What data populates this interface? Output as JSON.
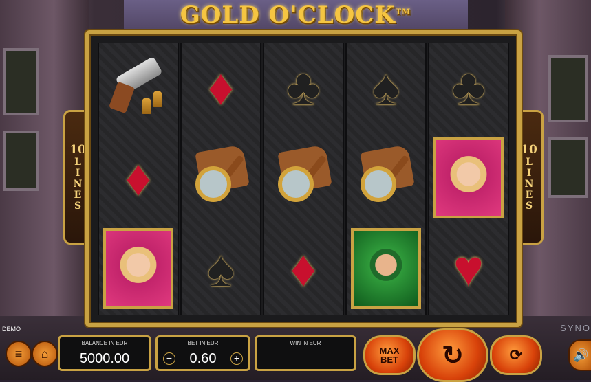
{
  "game": {
    "title": "GOLD O'CLOCK",
    "trademark": "TM",
    "provider": "SYNO"
  },
  "lines_badge": {
    "number": "10",
    "word": "LINES"
  },
  "reels": [
    [
      "revolver",
      "diamond",
      "lady"
    ],
    [
      "diamond",
      "magnifier",
      "spade"
    ],
    [
      "club",
      "magnifier",
      "diamond"
    ],
    [
      "spade",
      "magnifier",
      "detective"
    ],
    [
      "club",
      "lady",
      "heart"
    ]
  ],
  "symbol_glyphs": {
    "diamond": "♦",
    "heart": "♥",
    "club": "♣",
    "spade": "♠"
  },
  "mode": "DEMO",
  "balance": {
    "label": "BALANCE IN EUR",
    "value": "5000.00"
  },
  "bet": {
    "label": "BET IN EUR",
    "value": "0.60",
    "minus": "−",
    "plus": "+"
  },
  "win": {
    "label": "WIN IN EUR",
    "value": ""
  },
  "buttons": {
    "menu_icon": "hamburger-icon",
    "home_icon": "home-icon",
    "max_bet": "MAX BET",
    "spin_icon": "spin-icon",
    "autoplay_icon": "autoplay-icon",
    "sound_icon": "speaker-icon"
  },
  "colors": {
    "gold": "#c9a243",
    "orange": "#e0601a",
    "red_suit": "#c8102e"
  }
}
